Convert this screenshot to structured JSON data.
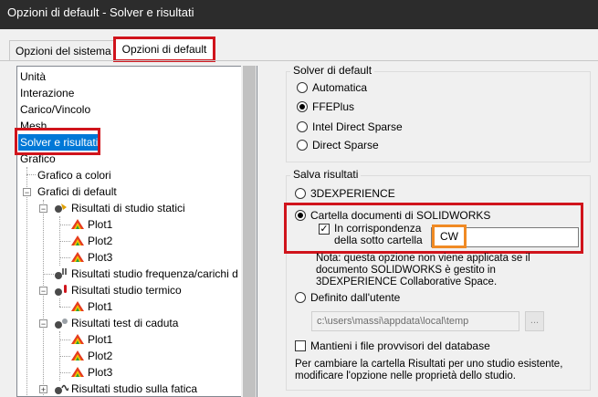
{
  "window": {
    "title": "Opzioni di default - Solver e risultati"
  },
  "tabs": [
    {
      "label": "Opzioni del sistema"
    },
    {
      "label": "Opzioni di default"
    }
  ],
  "tree": {
    "items": [
      {
        "label": "Unità"
      },
      {
        "label": "Interazione"
      },
      {
        "label": "Carico/Vincolo"
      },
      {
        "label": "Mesh"
      },
      {
        "label": "Solver e risultati"
      },
      {
        "label": "Grafico"
      },
      {
        "label": "Grafico a colori"
      },
      {
        "label": "Grafici di default"
      },
      {
        "label": "Risultati di studio statici"
      },
      {
        "label": "Plot1"
      },
      {
        "label": "Plot2"
      },
      {
        "label": "Plot3"
      },
      {
        "label": "Risultati studio frequenza/carichi d"
      },
      {
        "label": "Risultati studio termico"
      },
      {
        "label": "Plot1"
      },
      {
        "label": "Risultati test di caduta"
      },
      {
        "label": "Plot1"
      },
      {
        "label": "Plot2"
      },
      {
        "label": "Plot3"
      },
      {
        "label": "Risultati studio sulla fatica"
      }
    ]
  },
  "solver_group": {
    "title": "Solver di default",
    "options": [
      {
        "label": "Automatica",
        "selected": false
      },
      {
        "label": "FFEPlus",
        "selected": true
      },
      {
        "label": "Intel Direct Sparse",
        "selected": false
      },
      {
        "label": "Direct Sparse",
        "selected": false
      }
    ]
  },
  "results_group": {
    "title": "Salva risultati",
    "opt_3dx": "3DEXPERIENCE",
    "opt_sw_folder": "Cartella documenti di SOLIDWORKS",
    "subfolder_line1": "In corrispondenza",
    "subfolder_line2": "della sotto cartella",
    "subfolder_value": "CW",
    "note_line1": "Nota: questa opzione non viene applicata se il",
    "note_line2": "documento SOLIDWORKS è gestito in",
    "note_line3": "3DEXPERIENCE Collaborative Space.",
    "opt_user": "Definito dall'utente",
    "user_path": "c:\\users\\massi\\appdata\\local\\temp",
    "browse_label": "...",
    "keep_temp": "Mantieni i file provvisori del database",
    "footer_line1": "Per cambiare la cartella Risultati per uno studio esistente,",
    "footer_line2": "modificare l'opzione nelle proprietà dello studio."
  },
  "colors": {
    "highlight_red": "#d0141c",
    "callout_orange": "#f08a24",
    "selection_blue": "#0078d7"
  }
}
